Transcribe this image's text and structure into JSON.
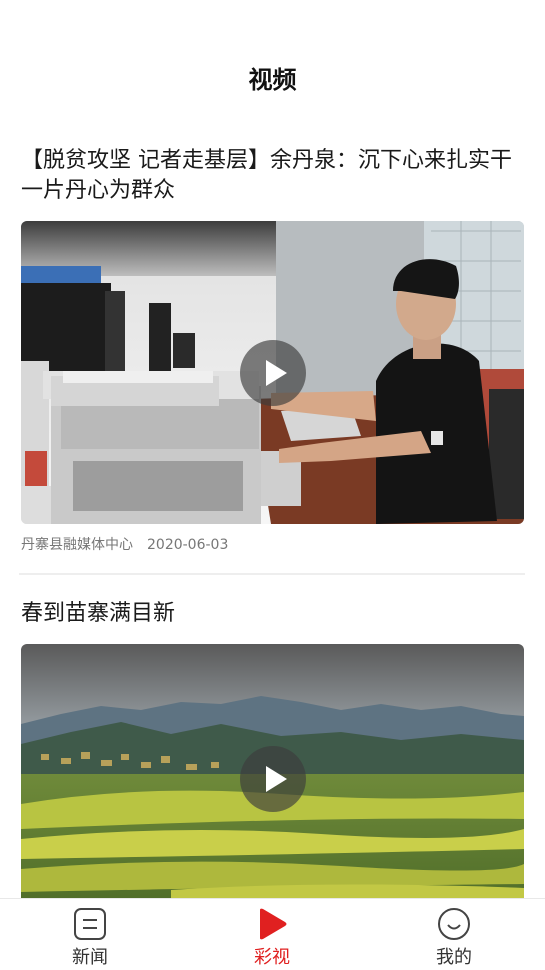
{
  "header": {
    "title": "视频"
  },
  "videos": [
    {
      "title": "【脱贫攻坚 记者走基层】余丹泉：沉下心来扎实干 一片丹心为群众",
      "source": "丹寨县融媒体中心",
      "date": "2020-06-03"
    },
    {
      "title": "春到苗寨满目新"
    }
  ],
  "tabbar": {
    "items": [
      {
        "label": "新闻",
        "icon": "news-icon"
      },
      {
        "label": "彩视",
        "icon": "video-play-icon",
        "active": true
      },
      {
        "label": "我的",
        "icon": "profile-icon"
      }
    ],
    "active_color": "#e02020"
  }
}
